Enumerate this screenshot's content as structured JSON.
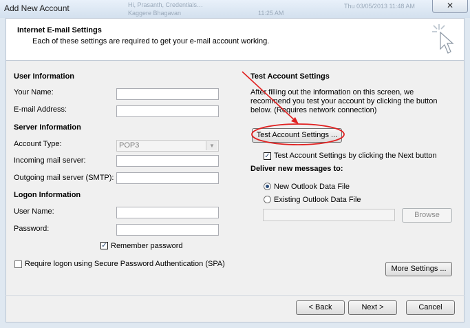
{
  "window": {
    "title": "Add New Account",
    "close_glyph": "✕",
    "background_text": [
      "Hi, Prasanth,  Credentials…",
      "Kaggere Bhagavan",
      "11:25 AM",
      "Thu 03/05/2013 11:48 AM"
    ]
  },
  "header": {
    "title": "Internet E-mail Settings",
    "subtitle": "Each of these settings are required to get your e-mail account working.",
    "icon": "cursor-sparkle-icon"
  },
  "user_info": {
    "heading": "User Information",
    "name_label": "Your Name:",
    "name_value": "",
    "email_label": "E-mail Address:",
    "email_value": ""
  },
  "server_info": {
    "heading": "Server Information",
    "account_type_label": "Account Type:",
    "account_type_value": "POP3",
    "incoming_label": "Incoming mail server:",
    "incoming_value": "",
    "outgoing_label": "Outgoing mail server (SMTP):",
    "outgoing_value": ""
  },
  "logon_info": {
    "heading": "Logon Information",
    "username_label": "User Name:",
    "username_value": "",
    "password_label": "Password:",
    "password_value": "",
    "remember_label": "Remember password",
    "remember_checked": true,
    "spa_label": "Require logon using Secure Password Authentication (SPA)",
    "spa_checked": false
  },
  "test_settings": {
    "heading": "Test Account Settings",
    "description": [
      "After filling out the information on this screen, we",
      "recommend you test your account by clicking the button",
      "below. (Requires network connection)"
    ],
    "button_label": "Test Account Settings ...",
    "next_test_label": "Test Account Settings by clicking the Next button",
    "next_test_checked": true
  },
  "deliver": {
    "heading": "Deliver new messages to:",
    "options": [
      "New Outlook Data File",
      "Existing Outlook Data File"
    ],
    "selected": 0,
    "path_value": "",
    "browse_label": "Browse"
  },
  "more_settings_label": "More Settings ...",
  "footer": {
    "back_label": "< Back",
    "next_label": "Next >",
    "cancel_label": "Cancel"
  },
  "colors": {
    "annotation_red": "#e02020",
    "window_frame": "#dfe8f1"
  }
}
